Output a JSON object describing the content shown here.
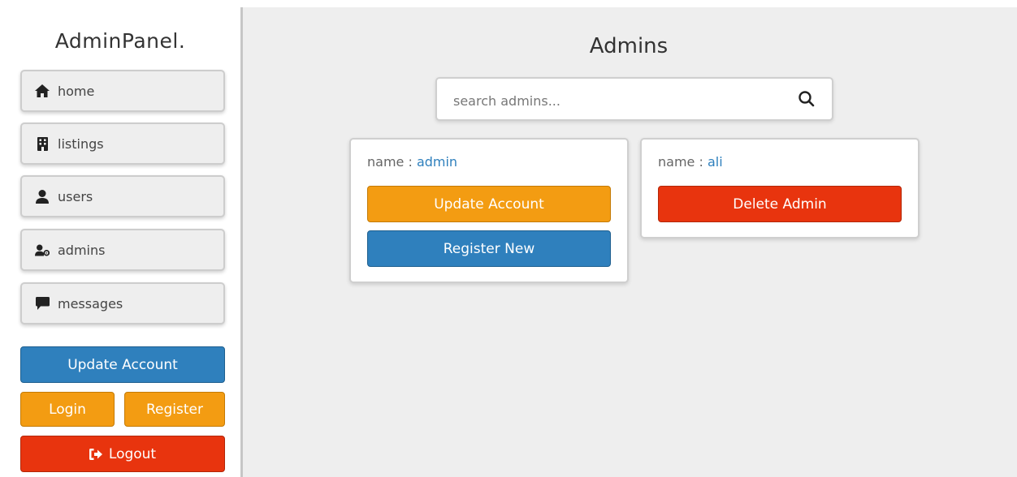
{
  "sidebar": {
    "logo": "AdminPanel.",
    "nav": [
      {
        "label": "home",
        "icon": "home-icon"
      },
      {
        "label": "listings",
        "icon": "building-icon"
      },
      {
        "label": "users",
        "icon": "user-icon"
      },
      {
        "label": "admins",
        "icon": "user-cog-icon"
      },
      {
        "label": "messages",
        "icon": "comment-icon"
      }
    ],
    "update_account": "Update Account",
    "login": "Login",
    "register": "Register",
    "logout": "Logout"
  },
  "main": {
    "title": "Admins",
    "search_placeholder": "search admins...",
    "cards": [
      {
        "name_label": "name : ",
        "name_value": "admin",
        "update": "Update Account",
        "register": "Register New"
      },
      {
        "name_label": "name : ",
        "name_value": "ali",
        "delete": "Delete Admin"
      }
    ]
  },
  "colors": {
    "blue": "#2f80bd",
    "orange": "#f39c12",
    "red": "#e8340e"
  }
}
